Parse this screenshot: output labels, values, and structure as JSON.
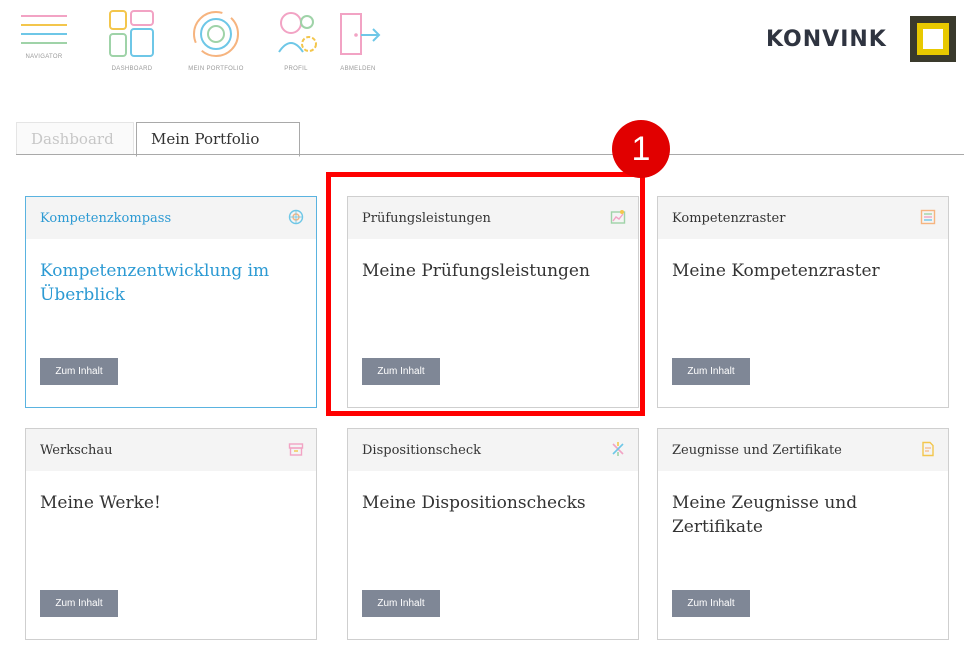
{
  "topnav": {
    "items": [
      {
        "label": "NAVIGATOR",
        "icon": "hamburger-menu-icon"
      },
      {
        "label": "DASHBOARD",
        "icon": "dashboard-grid-icon"
      },
      {
        "label": "MEIN PORTFOLIO",
        "icon": "portfolio-rings-icon"
      },
      {
        "label": "PROFIL",
        "icon": "profile-gears-icon"
      },
      {
        "label": "ABMELDEN",
        "icon": "logout-door-icon"
      }
    ],
    "brand": "KONVINK",
    "colors": {
      "pink": "#f2a3c4",
      "yellow": "#f3c64c",
      "blue": "#6ec7e7",
      "orange": "#f6b47f",
      "green": "#9fd3a8"
    }
  },
  "tabs": [
    {
      "label": "Dashboard",
      "active": false
    },
    {
      "label": "Mein Portfolio",
      "active": true
    }
  ],
  "cards": [
    {
      "title": "Kompetenzkompass",
      "body": "Kompetenzentwicklung im Überblick",
      "button": "Zum Inhalt",
      "icon": "compass-icon",
      "active": true
    },
    {
      "title": "Prüfungsleistungen",
      "body": "Meine Prüfungsleistungen",
      "button": "Zum Inhalt",
      "icon": "exam-chart-icon",
      "active": false
    },
    {
      "title": "Kompetenzraster",
      "body": "Meine Kompetenzraster",
      "button": "Zum Inhalt",
      "icon": "grid-sliders-icon",
      "active": false
    },
    {
      "title": "Werkschau",
      "body": "Meine Werke!",
      "button": "Zum Inhalt",
      "icon": "archive-box-icon",
      "active": false
    },
    {
      "title": "Dispositionscheck",
      "body": "Meine Dispositionschecks",
      "button": "Zum Inhalt",
      "icon": "sparkle-check-icon",
      "active": false
    },
    {
      "title": "Zeugnisse und Zertifikate",
      "body": "Meine Zeugnisse und Zertifikate",
      "button": "Zum Inhalt",
      "icon": "certificate-doc-icon",
      "active": false
    }
  ],
  "annotation": {
    "number": "1",
    "color": "#e10000"
  }
}
